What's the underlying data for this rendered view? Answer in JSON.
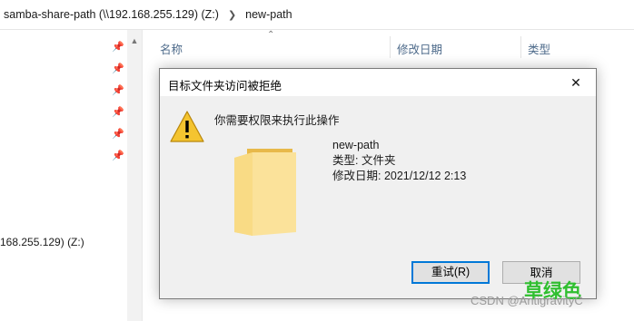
{
  "breadcrumb": {
    "parent": "samba-share-path (\\\\192.168.255.129) (Z:)",
    "current": "new-path"
  },
  "nav": {
    "drive_label": "168.255.129) (Z:)"
  },
  "columns": {
    "name": "名称",
    "date": "修改日期",
    "type": "类型"
  },
  "dialog": {
    "title": "目标文件夹访问被拒绝",
    "message": "你需要权限来执行此操作",
    "file_name": "new-path",
    "file_type": "类型: 文件夹",
    "file_date": "修改日期: 2021/12/12 2:13",
    "retry_label": "重试(R)",
    "cancel_label": "取消"
  },
  "watermark": {
    "green": "草绿色",
    "csdn": "CSDN @AntigravityC"
  },
  "colors": {
    "accent": "#0078d7",
    "warning": "#f4c430"
  }
}
